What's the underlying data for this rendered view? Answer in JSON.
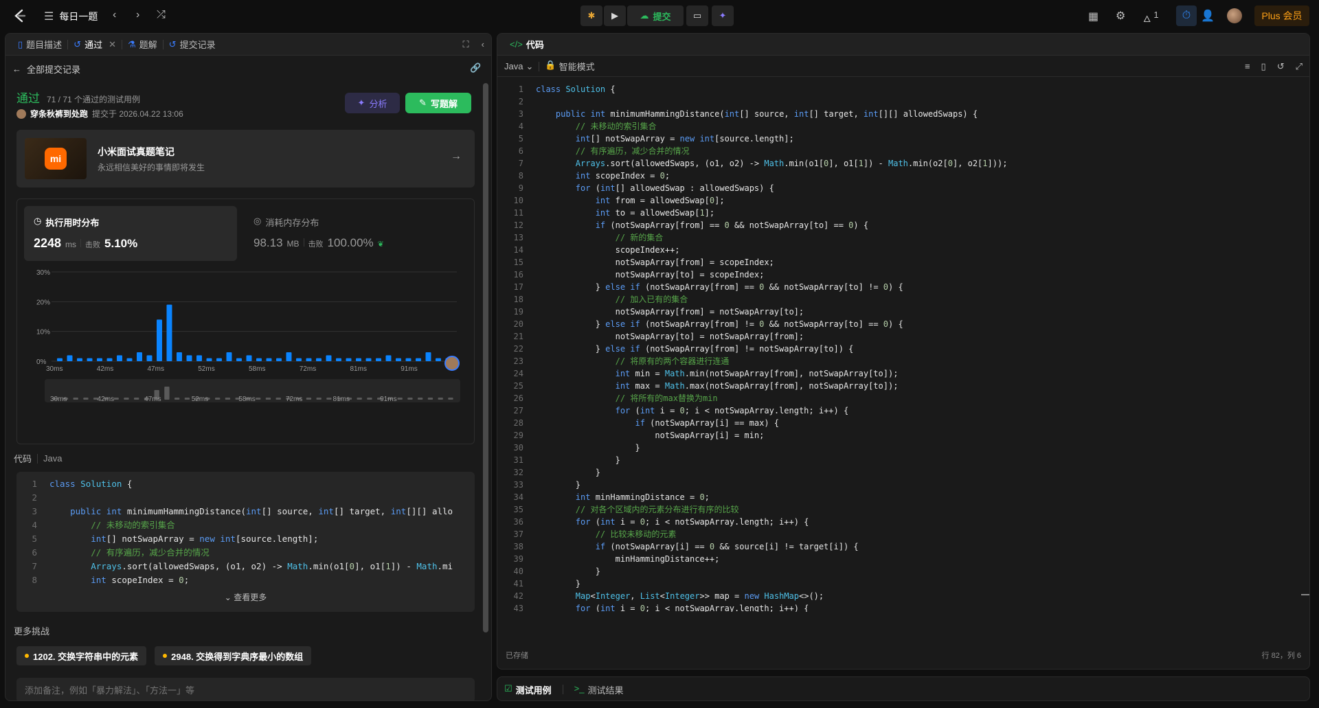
{
  "topbar": {
    "problem_list": "每日一题",
    "submit": "提交",
    "streak": "1",
    "plus": "Plus 会员"
  },
  "left": {
    "tabs": [
      "题目描述",
      "通过",
      "题解",
      "提交记录"
    ],
    "back": "全部提交记录",
    "status": "通过",
    "tests": "71 / 71 个通过的测试用例",
    "user": "穿条秋裤到处跑",
    "submitted": "提交于 2026.04.22 13:06",
    "analyze": "分析",
    "write_solution": "写题解",
    "promo": {
      "title": "小米面试真题笔记",
      "subtitle": "永远相信美好的事情即将发生",
      "logo": "mi"
    },
    "runtime": {
      "title": "执行用时分布",
      "value": "2248",
      "unit": "ms",
      "beats_label": "击败",
      "beats": "5.10%"
    },
    "memory": {
      "title": "消耗内存分布",
      "value": "98.13",
      "unit": "MB",
      "beats_label": "击败",
      "beats": "100.00%"
    },
    "code_label": "代码",
    "lang": "Java",
    "see_more": "查看更多",
    "more": "更多挑战",
    "challenges": [
      "1202. 交换字符串中的元素",
      "2948. 交换得到字典序最小的数组"
    ],
    "note_placeholder": "添加备注，例如「暴力解法」、「方法一」等"
  },
  "chart_data": {
    "type": "bar",
    "title": "执行用时分布",
    "x_ticks": [
      "30ms",
      "42ms",
      "47ms",
      "52ms",
      "58ms",
      "72ms",
      "81ms",
      "91ms"
    ],
    "y_ticks": [
      "30%",
      "20%",
      "10%",
      "0%"
    ],
    "ylim": [
      0,
      30
    ],
    "values": [
      1,
      2,
      1,
      1,
      1,
      1,
      2,
      1,
      3,
      2,
      14,
      19,
      3,
      2,
      2,
      1,
      1,
      3,
      1,
      2,
      1,
      1,
      1,
      3,
      1,
      1,
      1,
      2,
      1,
      1,
      1,
      1,
      1,
      2,
      1,
      1,
      1,
      3,
      1,
      1
    ],
    "bar_color": "#0a84ff"
  },
  "right": {
    "title": "代码",
    "lang": "Java",
    "mode": "智能模式",
    "saved": "已存储",
    "cursor": "行 82，列 6",
    "bottom_tabs": [
      "测试用例",
      "测试结果"
    ]
  }
}
